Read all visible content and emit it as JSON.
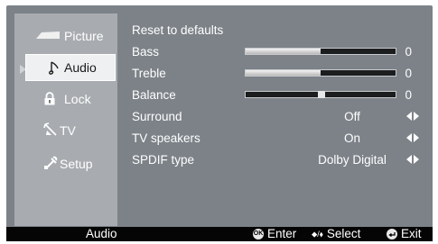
{
  "sidebar": {
    "items": [
      {
        "label": "Picture",
        "icon": "picture-icon"
      },
      {
        "label": "Audio",
        "icon": "audio-icon",
        "active": true
      },
      {
        "label": "Lock",
        "icon": "lock-icon"
      },
      {
        "label": "TV",
        "icon": "tv-antenna-icon"
      },
      {
        "label": "Setup",
        "icon": "setup-icon"
      }
    ]
  },
  "audio": {
    "reset_label": "Reset to defaults",
    "bass": {
      "label": "Bass",
      "value": "0",
      "level": 0.5
    },
    "treble": {
      "label": "Treble",
      "value": "0",
      "level": 0.5
    },
    "balance": {
      "label": "Balance",
      "value": "0",
      "level": 0.5
    },
    "surround": {
      "label": "Surround",
      "value": "Off"
    },
    "tv_speakers": {
      "label": "TV speakers",
      "value": "On"
    },
    "spdif": {
      "label": "SPDIF type",
      "value": "Dolby Digital"
    }
  },
  "bottombar": {
    "title": "Audio",
    "ok_glyph": "OK",
    "enter_label": "Enter",
    "select_glyph": "⬥/⬧",
    "select_label": "Select",
    "exit_label": "Exit"
  }
}
